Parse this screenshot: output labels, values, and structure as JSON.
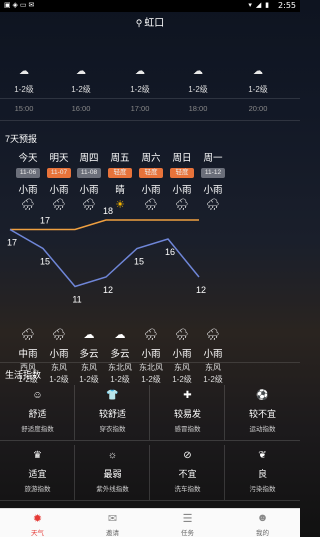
{
  "status_bar": {
    "time": "2:55",
    "left_icons": "▣ ◈ ▭ ✉",
    "right_icons": "▾ ◢ ▮"
  },
  "location": {
    "pin_icon": "location-pin-icon",
    "city": "虹口"
  },
  "hourly": [
    {
      "icon": "cloud-icon",
      "wind": "1-2级",
      "time": "15:00"
    },
    {
      "icon": "cloud-icon",
      "wind": "1-2级",
      "time": "16:00"
    },
    {
      "icon": "cloud-icon",
      "wind": "1-2级",
      "time": "17:00"
    },
    {
      "icon": "cloud-icon",
      "wind": "1-2级",
      "time": "18:00"
    },
    {
      "icon": "cloud-icon",
      "wind": "1-2级",
      "time": "20:00"
    }
  ],
  "forecast_title": "7天预报",
  "forecast": [
    {
      "day": "今天",
      "date": "11-06",
      "highlight": false,
      "day_cond": "小雨",
      "day_icon": "rain-cloud-icon",
      "high": 17,
      "low": 17,
      "night_icon": "rain-cloud-icon",
      "night_cond": "中雨",
      "night_wind": "西风",
      "night_level": "1-2级"
    },
    {
      "day": "明天",
      "date": "11-07",
      "highlight": true,
      "day_cond": "小雨",
      "day_icon": "rain-cloud-icon",
      "high": 17,
      "low": 15,
      "night_icon": "rain-cloud-icon",
      "night_cond": "小雨",
      "night_wind": "东风",
      "night_level": "1-2级"
    },
    {
      "day": "周四",
      "date": "11-08",
      "highlight": false,
      "day_cond": "小雨",
      "day_icon": "rain-cloud-icon",
      "high": 17,
      "low": 11,
      "night_icon": "cloudy-icon",
      "night_cond": "多云",
      "night_wind": "东风",
      "night_level": "1-2级"
    },
    {
      "day": "周五",
      "date": "轻度",
      "highlight": true,
      "day_cond": "晴",
      "day_icon": "sun-icon",
      "high": 18,
      "low": 12,
      "night_icon": "cloudy-icon",
      "night_cond": "多云",
      "night_wind": "东北风",
      "night_level": "1-2级"
    },
    {
      "day": "周六",
      "date": "轻度",
      "highlight": true,
      "day_cond": "小雨",
      "day_icon": "rain-cloud-icon",
      "high": 18,
      "low": 15,
      "night_icon": "rain-cloud-icon",
      "night_cond": "小雨",
      "night_wind": "东北风",
      "night_level": "1-2级"
    },
    {
      "day": "周日",
      "date": "轻度",
      "highlight": true,
      "day_cond": "小雨",
      "day_icon": "rain-cloud-icon",
      "high": 18,
      "low": 16,
      "night_icon": "rain-cloud-icon",
      "night_cond": "小雨",
      "night_wind": "东风",
      "night_level": "1-2级"
    },
    {
      "day": "周一",
      "date": "11-12",
      "highlight": false,
      "day_cond": "小雨",
      "day_icon": "rain-cloud-icon",
      "high": 18,
      "low": 12,
      "night_icon": "rain-cloud-icon",
      "night_cond": "小雨",
      "night_wind": "东风",
      "night_level": "1-2级"
    }
  ],
  "temp_labels": {
    "high_shown": [
      null,
      "17",
      null,
      "18",
      null,
      null,
      null
    ],
    "low_shown": [
      "17",
      "15",
      "11",
      "12",
      "15",
      "16",
      "12"
    ]
  },
  "colors": {
    "high_line": "#f0a040",
    "low_line": "#6f86d8",
    "accent": "#e53935",
    "badge": "#e8733a"
  },
  "life_title": "生活指数",
  "life_index": [
    {
      "icon": "smile-icon",
      "value": "舒适",
      "name": "舒适度指数"
    },
    {
      "icon": "shirt-icon",
      "value": "较舒适",
      "name": "穿衣指数"
    },
    {
      "icon": "pill-icon",
      "value": "较易发",
      "name": "感冒指数"
    },
    {
      "icon": "ball-icon",
      "value": "较不宜",
      "name": "运动指数"
    },
    {
      "icon": "travel-icon",
      "value": "适宜",
      "name": "旅游指数"
    },
    {
      "icon": "uv-icon",
      "value": "最弱",
      "name": "紫外线指数"
    },
    {
      "icon": "car-wash-icon",
      "value": "不宜",
      "name": "洗车指数"
    },
    {
      "icon": "leaf-icon",
      "value": "良",
      "name": "污染指数"
    }
  ],
  "tabs": [
    {
      "icon": "weather-icon",
      "label": "天气",
      "active": true
    },
    {
      "icon": "mail-icon",
      "label": "邀请",
      "active": false
    },
    {
      "icon": "task-icon",
      "label": "任务",
      "active": false
    },
    {
      "icon": "profile-icon",
      "label": "我的",
      "active": false
    }
  ]
}
